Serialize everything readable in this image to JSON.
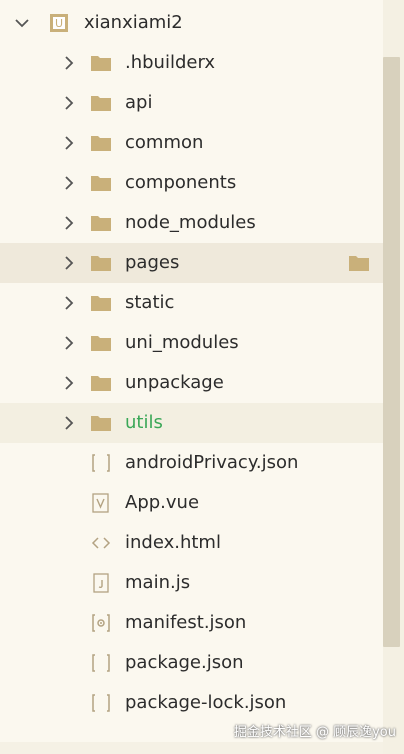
{
  "project": {
    "name": "xianxiami2",
    "badge": "U"
  },
  "items": [
    {
      "label": ".hbuilderx",
      "kind": "folder"
    },
    {
      "label": "api",
      "kind": "folder"
    },
    {
      "label": "common",
      "kind": "folder"
    },
    {
      "label": "components",
      "kind": "folder"
    },
    {
      "label": "node_modules",
      "kind": "folder"
    },
    {
      "label": "pages",
      "kind": "folder",
      "state": "hover"
    },
    {
      "label": "static",
      "kind": "folder"
    },
    {
      "label": "uni_modules",
      "kind": "folder"
    },
    {
      "label": "unpackage",
      "kind": "folder"
    },
    {
      "label": "utils",
      "kind": "folder",
      "state": "selected"
    },
    {
      "label": "androidPrivacy.json",
      "kind": "json"
    },
    {
      "label": "App.vue",
      "kind": "vue"
    },
    {
      "label": "index.html",
      "kind": "html"
    },
    {
      "label": "main.js",
      "kind": "js"
    },
    {
      "label": "manifest.json",
      "kind": "manifest"
    },
    {
      "label": "package.json",
      "kind": "json"
    },
    {
      "label": "package-lock.json",
      "kind": "json"
    }
  ],
  "watermark": "掘金技术社区 @ 顾辰逸you",
  "colors": {
    "folder": "#c9b07a",
    "selectedText": "#3aa757",
    "hoverBg": "#efe9db",
    "selectedBg": "#f3efe1"
  }
}
